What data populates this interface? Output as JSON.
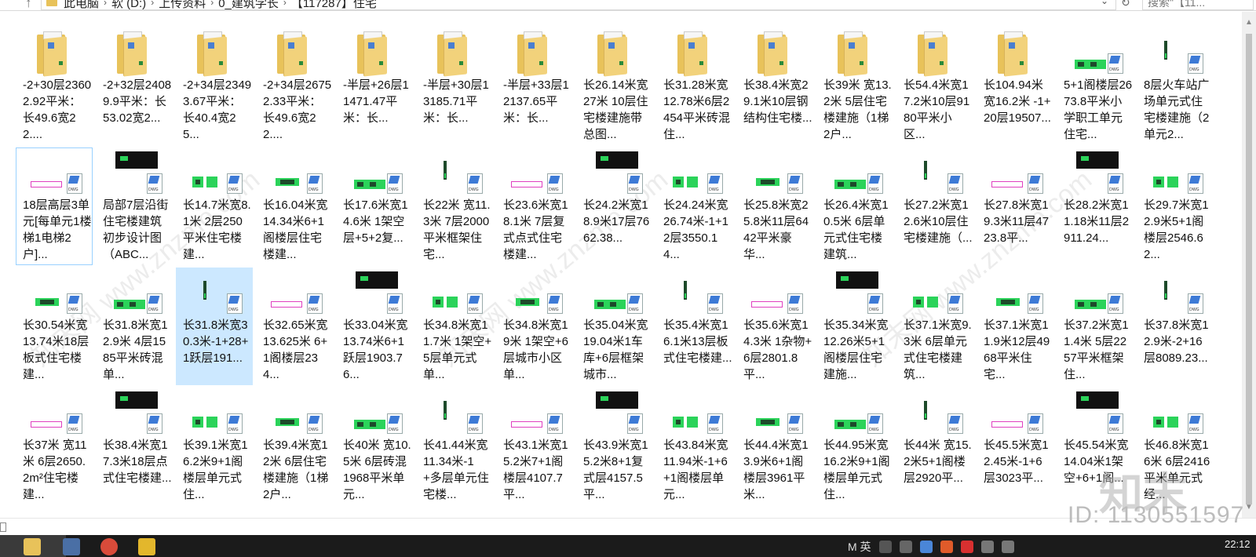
{
  "address_bar": {
    "crumbs": [
      "此电脑",
      "软 (D:)",
      "上传资料",
      "0_建筑学长",
      "【117287】住宅"
    ],
    "search_placeholder": "搜索\"【11..."
  },
  "files": [
    {
      "label": "-2+30层23602.92平米：长49.6宽22....",
      "type": "folder"
    },
    {
      "label": "-2+32层24089.9平米：长53.02宽2...",
      "type": "folder"
    },
    {
      "label": "-2+34层23493.67平米：长40.4宽25...",
      "type": "folder"
    },
    {
      "label": "-2+34层26752.33平米：长49.6宽22....",
      "type": "folder"
    },
    {
      "label": "-半层+26层11471.47平米：长...",
      "type": "folder"
    },
    {
      "label": "-半层+30层13185.71平米：长...",
      "type": "folder"
    },
    {
      "label": "-半层+33层12137.65平米：长...",
      "type": "folder"
    },
    {
      "label": "长26.14米宽27米 10层住宅楼建施带总图...",
      "type": "folder"
    },
    {
      "label": "长31.28米宽12.78米6层2454平米砖混住...",
      "type": "folder"
    },
    {
      "label": "长38.4米宽29.1米10层钢结构住宅楼...",
      "type": "folder"
    },
    {
      "label": "长39米 宽13.2米 5层住宅楼建施（1梯2户...",
      "type": "folder"
    },
    {
      "label": "长54.4米宽17.2米10层9180平米小区...",
      "type": "folder"
    },
    {
      "label": "长104.94米 宽16.2米 -1+20层19507...",
      "type": "folder"
    },
    {
      "label": "5+1阁楼层2673.8平米小学职工单元住宅...",
      "type": "dwg"
    },
    {
      "label": "8层火车站广场单元式住宅楼建施（2单元2...",
      "type": "dwg"
    },
    {
      "label": "18层高层3单元[每单元1楼梯1电梯2户]...",
      "type": "dwg"
    },
    {
      "label": "局部7层沿街住宅楼建筑初步设计图（ABC...",
      "type": "dwg"
    },
    {
      "label": "长14.7米宽8.1米 2层250平米住宅楼建...",
      "type": "dwg"
    },
    {
      "label": "长16.04米宽14.34米6+1阁楼层住宅楼建...",
      "type": "dwg"
    },
    {
      "label": "长17.6米宽14.6米 1架空层+5+2复...",
      "type": "dwg"
    },
    {
      "label": "长22米 宽11.3米 7层2000平米框架住宅...",
      "type": "dwg"
    },
    {
      "label": "长23.6米宽18.1米 7层复式点式住宅楼建...",
      "type": "dwg"
    },
    {
      "label": "长24.2米宽18.9米17层7662.38...",
      "type": "dwg"
    },
    {
      "label": "长24.24米宽26.74米-1+12层3550.14...",
      "type": "dwg"
    },
    {
      "label": "长25.8米宽25.8米11层6442平米豪华...",
      "type": "dwg"
    },
    {
      "label": "长26.4米宽10.5米 6层单元式住宅楼建筑...",
      "type": "dwg"
    },
    {
      "label": "长27.2米宽12.6米10层住宅楼建施（...",
      "type": "dwg"
    },
    {
      "label": "长27.8米宽19.3米11层4723.8平...",
      "type": "dwg"
    },
    {
      "label": "长28.2米宽11.18米11层2911.24...",
      "type": "dwg"
    },
    {
      "label": "长29.7米宽12.9米5+1阁楼层2546.62...",
      "type": "dwg"
    },
    {
      "label": "长30.54米宽13.74米18层板式住宅楼建...",
      "type": "dwg"
    },
    {
      "label": "长31.8米宽12.9米 4层1585平米砖混单...",
      "type": "dwg"
    },
    {
      "label": "长31.8米宽30.3米-1+28+1跃层191...",
      "type": "dwg"
    },
    {
      "label": "长32.65米宽13.625米 6+1阁楼层234...",
      "type": "dwg"
    },
    {
      "label": "长33.04米宽13.74米6+1跃层1903.76...",
      "type": "dwg"
    },
    {
      "label": "长34.8米宽11.7米 1架空+5层单元式单...",
      "type": "dwg"
    },
    {
      "label": "长34.8米宽19米 1架空+6层城市小区单...",
      "type": "dwg"
    },
    {
      "label": "长35.04米宽19.04米1车库+6层框架城市...",
      "type": "dwg"
    },
    {
      "label": "长35.4米宽16.1米13层板式住宅楼建...",
      "type": "dwg"
    },
    {
      "label": "长35.6米宽14.3米 1杂物+6层2801.8平...",
      "type": "dwg"
    },
    {
      "label": "长35.34米宽12.26米5+1阁楼层住宅建施...",
      "type": "dwg"
    },
    {
      "label": "长37.1米宽9.3米 6层单元式住宅楼建筑...",
      "type": "dwg"
    },
    {
      "label": "长37.1米宽11.9米12层4968平米住宅...",
      "type": "dwg"
    },
    {
      "label": "长37.2米宽11.4米 5层2257平米框架住...",
      "type": "dwg"
    },
    {
      "label": "长37.8米宽12.9米-2+16层8089.23...",
      "type": "dwg"
    },
    {
      "label": "长37米 宽11米 6层2650.2m²住宅楼建...",
      "type": "dwg"
    },
    {
      "label": "长38.4米宽17.3米18层点式住宅楼建...",
      "type": "dwg"
    },
    {
      "label": "长39.1米宽16.2米9+1阁楼层单元式住...",
      "type": "dwg"
    },
    {
      "label": "长39.4米宽12米 6层住宅楼建施（1梯2户...",
      "type": "dwg"
    },
    {
      "label": "长40米 宽10.5米 6层砖混1968平米单元...",
      "type": "dwg"
    },
    {
      "label": "长41.44米宽11.34米-1+多层单元住宅楼...",
      "type": "dwg"
    },
    {
      "label": "长43.1米宽15.2米7+1阁楼层4107.7平...",
      "type": "dwg"
    },
    {
      "label": "长43.9米宽15.2米8+1复式层4157.5平...",
      "type": "dwg"
    },
    {
      "label": "长43.84米宽11.94米-1+6+1阁楼层单元...",
      "type": "dwg"
    },
    {
      "label": "长44.4米宽13.9米6+1阁楼层3961平米...",
      "type": "dwg"
    },
    {
      "label": "长44.95米宽16.2米9+1阁楼层单元式住...",
      "type": "dwg"
    },
    {
      "label": "长44米 宽15.2米5+1阁楼层2920平...",
      "type": "dwg"
    },
    {
      "label": "长45.5米宽12.45米-1+6层3023平...",
      "type": "dwg"
    },
    {
      "label": "长45.54米宽14.04米1架空+6+1阁...",
      "type": "dwg"
    },
    {
      "label": "长46.8米宽16米 6层2416平米单元式经...",
      "type": "dwg"
    }
  ],
  "watermarks": {
    "id_text": "ID: 1130551597",
    "logo_text": "知末"
  },
  "taskbar": {
    "tray_text": "M 英",
    "clock": "22:12"
  },
  "colors": {
    "selected_bg": "#cce8ff",
    "focus_border": "#99d1ff",
    "folder": "#e8c25a",
    "cad_green": "#2bd35a"
  }
}
